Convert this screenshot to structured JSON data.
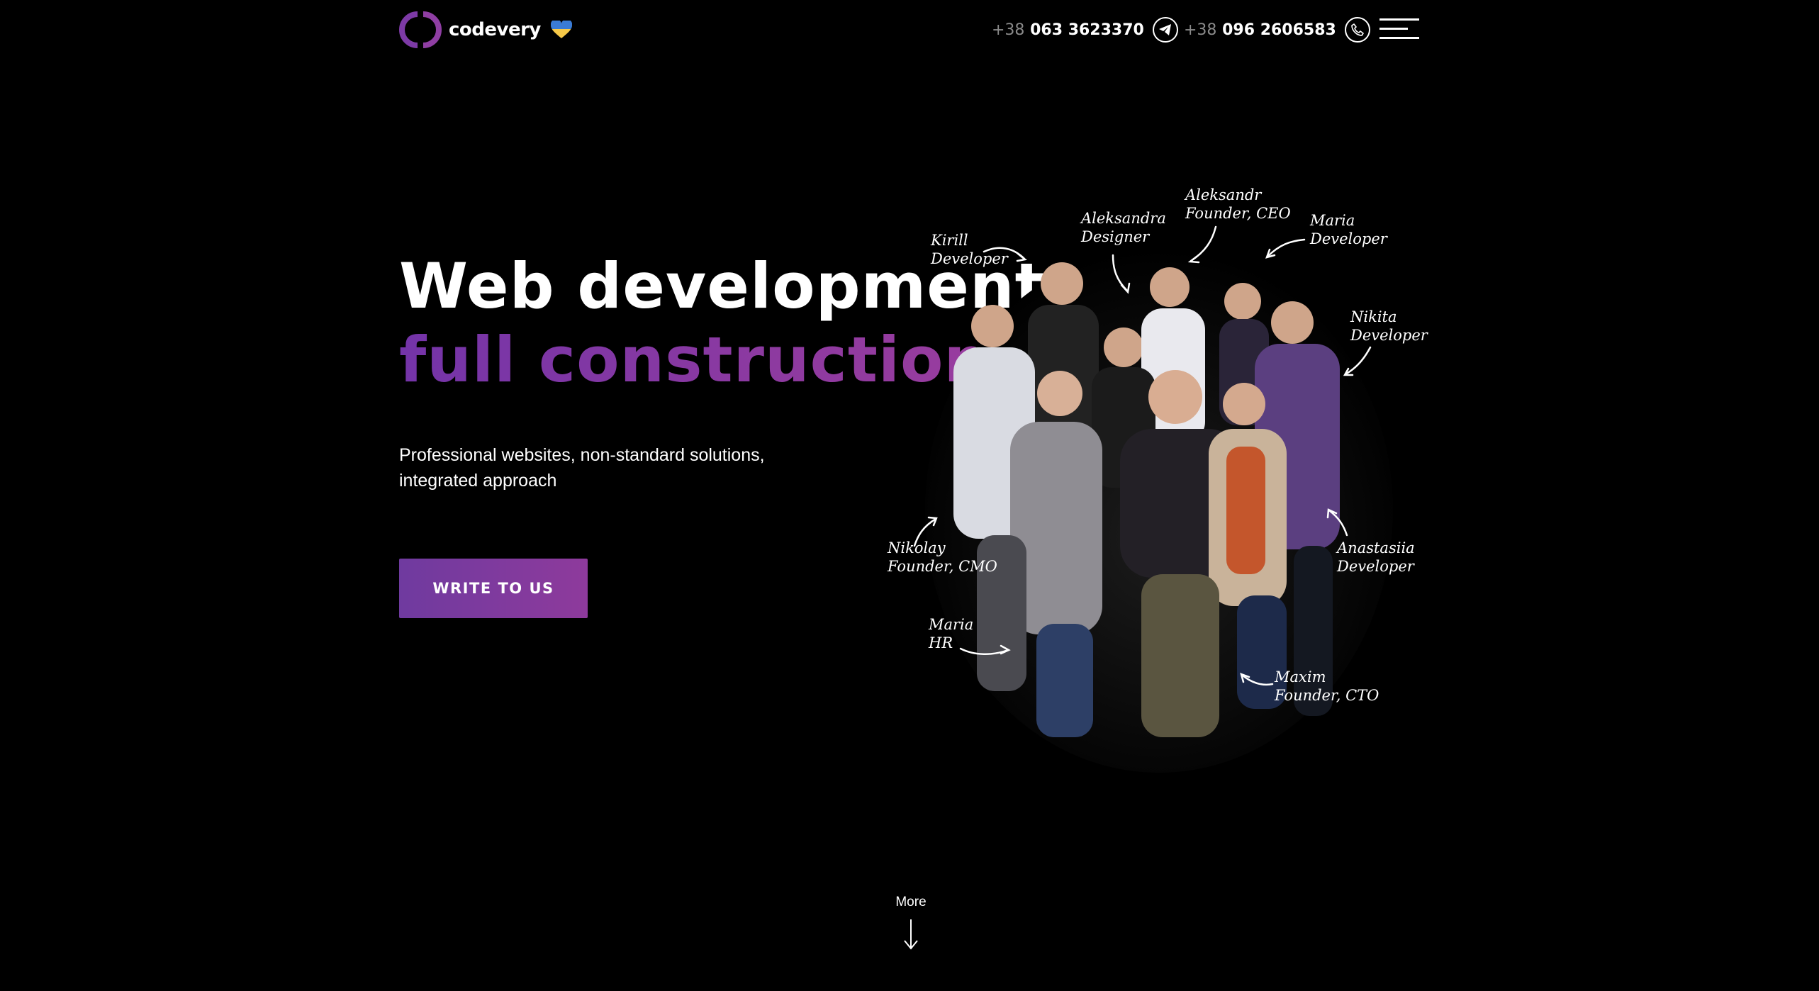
{
  "header": {
    "brand": "codevery",
    "phones": [
      {
        "code": "+38",
        "number": "063 3623370",
        "icon": "telegram-icon"
      },
      {
        "code": "+38",
        "number": "096 2606583",
        "icon": "phone-icon"
      }
    ],
    "menu_icon": "hamburger-menu-icon"
  },
  "hero": {
    "title_line1": "Web development",
    "title_line2": "full construction",
    "subtitle": "Professional websites, non-standard solutions, integrated approach",
    "cta_label": "WRITE TO US"
  },
  "team": {
    "members": [
      {
        "name": "Kirill",
        "role": "Developer"
      },
      {
        "name": "Aleksandra",
        "role": "Designer"
      },
      {
        "name": "Aleksandr",
        "role": "Founder, CEO"
      },
      {
        "name": "Maria",
        "role": "Developer"
      },
      {
        "name": "Nikita",
        "role": "Developer"
      },
      {
        "name": "Nikolay",
        "role": "Founder, CMO"
      },
      {
        "name": "Anastasiia",
        "role": "Developer"
      },
      {
        "name": "Maria",
        "role": "HR"
      },
      {
        "name": "Maxim",
        "role": "Founder, CTO"
      }
    ]
  },
  "more": {
    "label": "More"
  },
  "colors": {
    "accent": "#7e37a3",
    "background": "#000000",
    "text": "#ffffff"
  }
}
